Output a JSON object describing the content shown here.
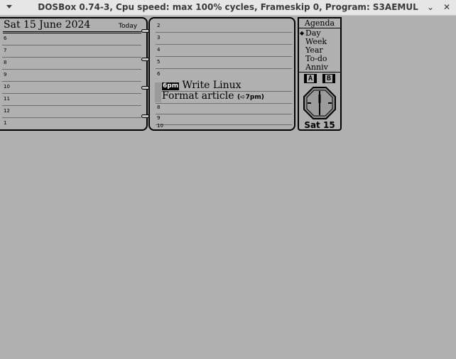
{
  "window": {
    "title": "DOSBox 0.74-3, Cpu speed: max 100% cycles, Frameskip  0, Program:  S3AEMUL",
    "minimize_glyph": "⌄",
    "close_glyph": "✕"
  },
  "diary": {
    "date_title": "Sat 15 June 2024",
    "today_label": "Today",
    "left_hours": [
      "6",
      "7",
      "8",
      "9",
      "10",
      "11",
      "12",
      "1"
    ],
    "right_hours": [
      "2",
      "3",
      "4",
      "5",
      "6",
      "7",
      "8",
      "9",
      "10"
    ],
    "appointment": {
      "start_time": "6pm",
      "line1": "Write Linux",
      "line2": "Format article",
      "end_time": "(➪7pm)"
    }
  },
  "sidebar": {
    "title": "Agenda",
    "views": [
      "Day",
      "Week",
      "Year",
      "To-do",
      "Anniv"
    ],
    "selected_view": "Day",
    "drive_a": "A",
    "drive_b": "B",
    "date_label": "Sat 15"
  },
  "colors": {
    "screen_bg": "#b0b0b0",
    "ink": "#000000",
    "titlebar_bg": "#e6e6e6"
  }
}
